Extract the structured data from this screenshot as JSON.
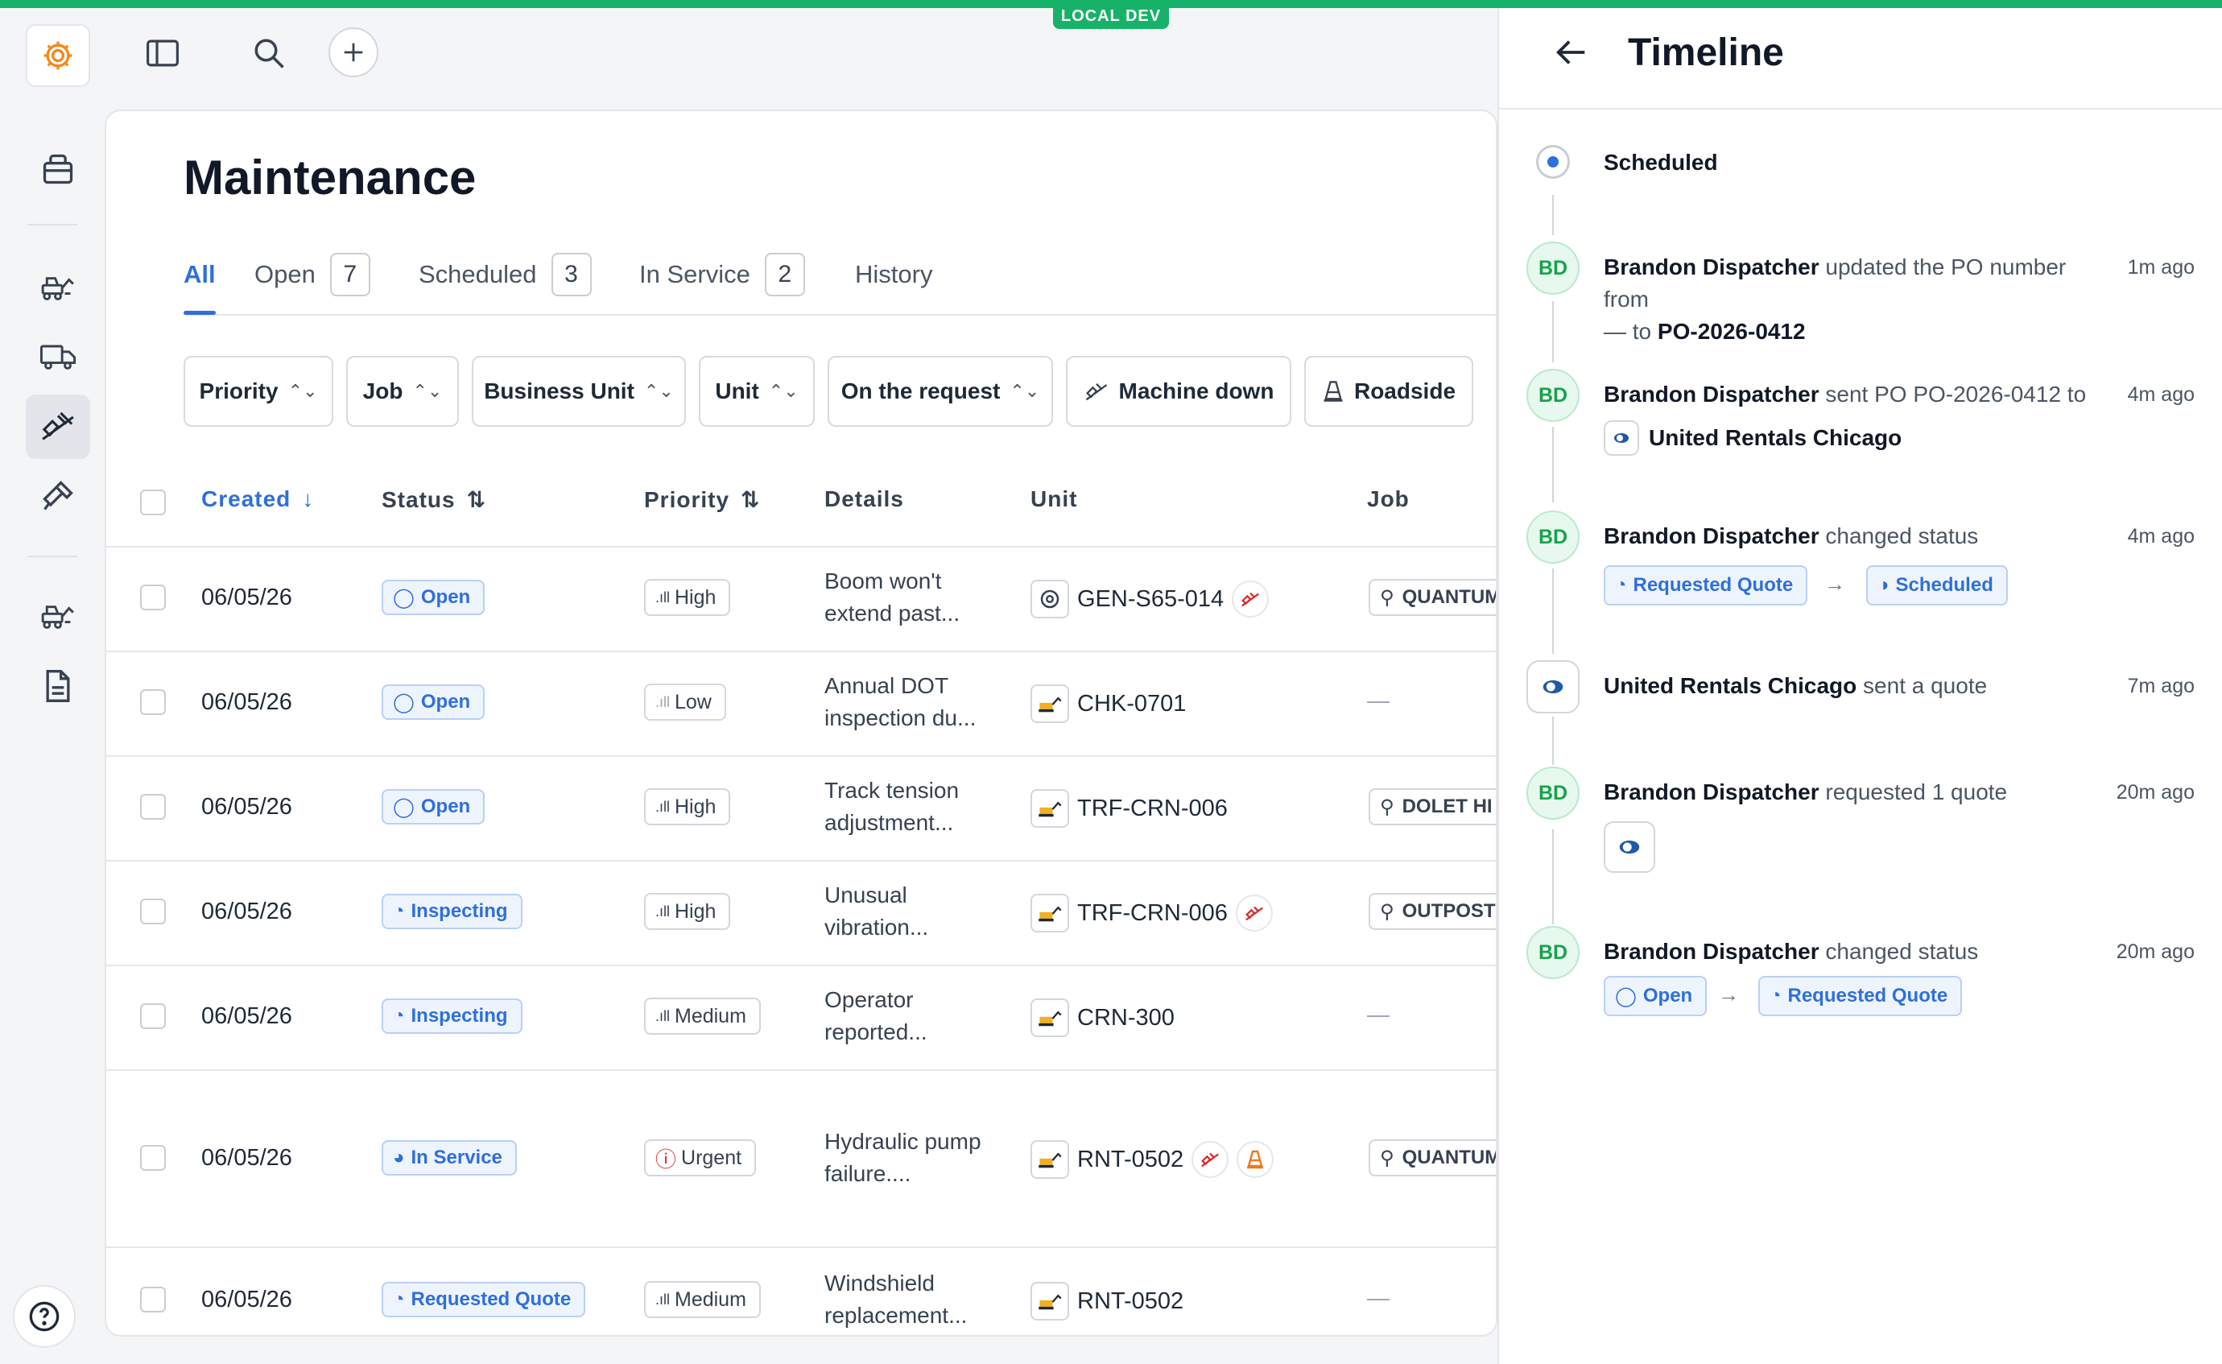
{
  "env_badge": "LOCAL DEV",
  "page": {
    "title": "Maintenance",
    "tabs": [
      {
        "label": "All",
        "count": ""
      },
      {
        "label": "Open",
        "count": "7"
      },
      {
        "label": "Scheduled",
        "count": "3"
      },
      {
        "label": "In Service",
        "count": "2"
      },
      {
        "label": "History",
        "count": ""
      }
    ],
    "filters": [
      "Priority",
      "Job",
      "Business Unit",
      "Unit",
      "On the request",
      "Machine down",
      "Roadside"
    ],
    "columns": [
      "Created",
      "Status",
      "Priority",
      "Details",
      "Unit",
      "Job"
    ],
    "rows": [
      {
        "created": "06/05/26",
        "status": "Open",
        "priority": "High",
        "details": "Boom won't extend past...",
        "unit": "GEN-S65-014",
        "job": "QUANTUM"
      },
      {
        "created": "06/05/26",
        "status": "Open",
        "priority": "Low",
        "details": "Annual DOT inspection du...",
        "unit": "CHK-0701",
        "job": "—"
      },
      {
        "created": "06/05/26",
        "status": "Open",
        "priority": "High",
        "details": "Track tension adjustment...",
        "unit": "TRF-CRN-006",
        "job": "DOLET HI"
      },
      {
        "created": "06/05/26",
        "status": "Inspecting",
        "priority": "High",
        "details": "Unusual vibration...",
        "unit": "TRF-CRN-006",
        "job": "OUTPOST"
      },
      {
        "created": "06/05/26",
        "status": "Inspecting",
        "priority": "Medium",
        "details": "Operator reported...",
        "unit": "CRN-300",
        "job": "—"
      },
      {
        "created": "06/05/26",
        "status": "In Service",
        "priority": "Urgent",
        "details": "Hydraulic pump failure....",
        "unit": "RNT-0502",
        "job": "QUANTUM"
      },
      {
        "created": "06/05/26",
        "status": "Requested Quote",
        "priority": "Medium",
        "details": "Windshield replacement...",
        "unit": "RNT-0502",
        "job": "—"
      }
    ]
  },
  "timeline": {
    "title": "Timeline",
    "current": "Scheduled",
    "events": [
      {
        "initials": "BD",
        "actor": "Brandon Dispatcher",
        "text": "updated the PO number from",
        "text2": "— to",
        "target": "PO-2026-0412",
        "time": "1m ago"
      },
      {
        "initials": "BD",
        "actor": "Brandon Dispatcher",
        "text": "sent PO PO-2026-0412 to",
        "vendor": "United Rentals Chicago",
        "time": "4m ago"
      },
      {
        "initials": "BD",
        "actor": "Brandon Dispatcher",
        "text": "changed status",
        "from": "Requested Quote",
        "to": "Scheduled",
        "time": "4m ago"
      },
      {
        "actor": "United Rentals Chicago",
        "text": "sent a quote",
        "time": "7m ago"
      },
      {
        "initials": "BD",
        "actor": "Brandon Dispatcher",
        "text": "requested 1 quote",
        "time": "20m ago"
      },
      {
        "initials": "BD",
        "actor": "Brandon Dispatcher",
        "text": "changed status",
        "from": "Open",
        "to": "Requested Quote",
        "time": "20m ago"
      }
    ]
  },
  "colors": {
    "accent": "#2f6fdb",
    "env": "#17b26a",
    "avatar_green": "#16a34a",
    "machine_down": "#dc2626",
    "roadside": "#ea7a1c"
  }
}
